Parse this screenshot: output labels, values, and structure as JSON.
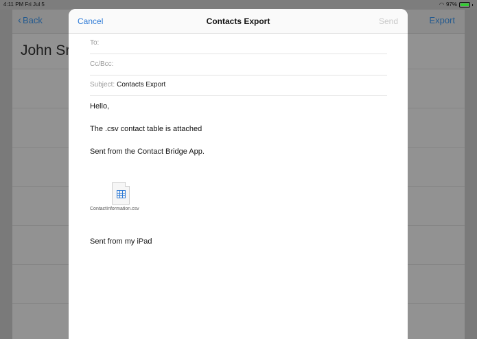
{
  "status_bar": {
    "time": "4:11 PM   Fri Jul 5",
    "battery": "97%",
    "battery_level": 0.97
  },
  "background_app": {
    "back_label": "Back",
    "export_label": "Export",
    "contact_name": "John Sr"
  },
  "mail": {
    "cancel_label": "Cancel",
    "title": "Contacts Export",
    "send_label": "Send",
    "to_label": "To:",
    "to_value": "",
    "cc_label": "Cc/Bcc:",
    "cc_value": "",
    "subject_label": "Subject:",
    "subject_value": "Contacts Export",
    "body_lines": [
      "Hello,",
      "The .csv contact table is attached",
      "Sent from the Contact Bridge App."
    ],
    "attachment_name": "ContactInformation.csv",
    "signature": "Sent from my iPad"
  }
}
